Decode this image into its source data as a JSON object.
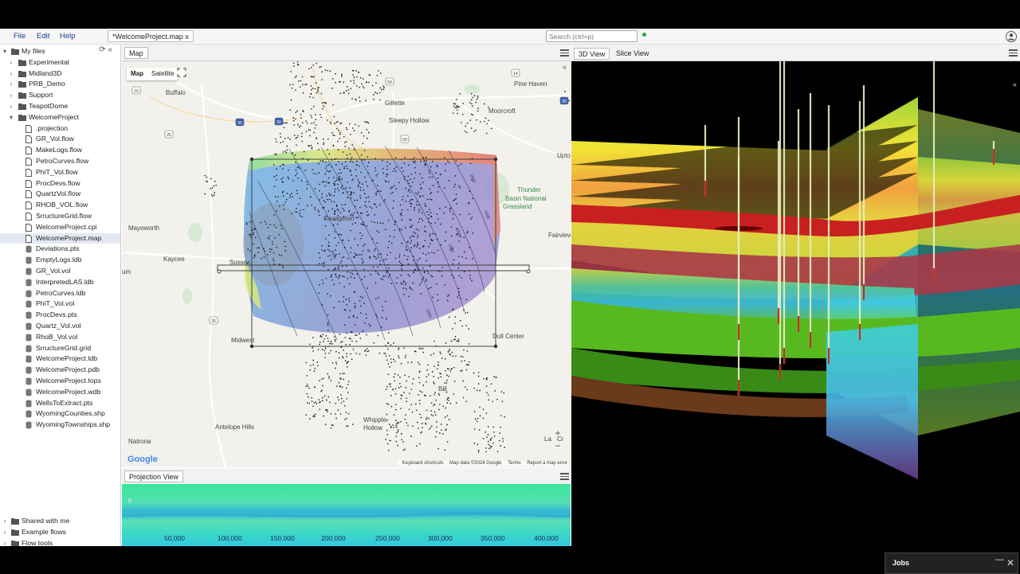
{
  "menu": {
    "file": "File",
    "edit": "Edit",
    "help": "Help"
  },
  "document_tab": "*WelcomeProject.map x",
  "search": {
    "placeholder": "Search (ctrl+p)"
  },
  "sidebar": {
    "root": "My files",
    "folders": [
      "Experimental",
      "Midland3D",
      "PRB_Demo",
      "Support",
      "TeapotDome"
    ],
    "open_folder": "WelcomeProject",
    "files": [
      {
        "name": ".projection",
        "type": "file-doc"
      },
      {
        "name": "GR_Vol.flow",
        "type": "file-doc"
      },
      {
        "name": "MakeLogs.flow",
        "type": "file-doc"
      },
      {
        "name": "PetroCurves.flow",
        "type": "file-doc"
      },
      {
        "name": "PhiT_Vol.flow",
        "type": "file-doc"
      },
      {
        "name": "ProcDevs.flow",
        "type": "file-doc"
      },
      {
        "name": "QuartzVol.flow",
        "type": "file-doc"
      },
      {
        "name": "RHOB_VOL.flow",
        "type": "file-doc"
      },
      {
        "name": "SrructureGrid.flow",
        "type": "file-doc"
      },
      {
        "name": "WelcomeProject.cpi",
        "type": "file-doc"
      },
      {
        "name": "WelcomeProject.map",
        "type": "file-doc",
        "selected": true
      },
      {
        "name": "Deviations.pts",
        "type": "database"
      },
      {
        "name": "EmptyLogs.ldb",
        "type": "database"
      },
      {
        "name": "GR_Vol.vol",
        "type": "database"
      },
      {
        "name": "InterpretedLAS.ldb",
        "type": "database"
      },
      {
        "name": "PetroCurves.ldb",
        "type": "database"
      },
      {
        "name": "PhiT_Vol.vol",
        "type": "database"
      },
      {
        "name": "ProcDevs.pts",
        "type": "database"
      },
      {
        "name": "Quartz_Vol.vol",
        "type": "database"
      },
      {
        "name": "RhoB_Vol.vol",
        "type": "database"
      },
      {
        "name": "SrructureGrid.grid",
        "type": "database"
      },
      {
        "name": "WelcomeProject.ldb",
        "type": "database"
      },
      {
        "name": "WelcomeProject.pdb",
        "type": "database"
      },
      {
        "name": "WelcomeProject.tops",
        "type": "database"
      },
      {
        "name": "WelcomeProject.wdb",
        "type": "database"
      },
      {
        "name": "WellsToExtract.pts",
        "type": "database"
      },
      {
        "name": "WyomingCounties.shp",
        "type": "database"
      },
      {
        "name": "WyomingTownships.shp",
        "type": "database"
      }
    ],
    "bottom": [
      "Shared with me",
      "Example flows",
      "Flow tools"
    ]
  },
  "map_panel": {
    "tab": "Map",
    "map_type": {
      "map": "Map",
      "satellite": "Satellite"
    },
    "places": [
      "Buffalo",
      "Gillette",
      "Sleepy Hollow",
      "Pine Haven",
      "Moorcroft",
      "Upto",
      "Thunder",
      "Basin National",
      "Grassland",
      "Mayoworth",
      "Kaycee",
      "Fairview",
      "Sussex",
      "um",
      "Midwest",
      "Dull Center",
      "Bill",
      "Antelope Hills",
      "Whipple",
      "Hollow",
      "Natrona",
      "La",
      "Cr",
      "Savageton"
    ],
    "highway_shields": [
      "16",
      "14",
      "90",
      "90",
      "59",
      "90",
      "25",
      "25",
      "59"
    ],
    "contour_labels": [
      "1500",
      "1500",
      "1000",
      "2500",
      "2000",
      "2000",
      "4000"
    ],
    "google": "Google",
    "footer": [
      "Keyboard shortcuts",
      "Map data ©2024 Google",
      "Terms",
      "Report a map error"
    ]
  },
  "projection_panel": {
    "tab": "Projection View",
    "marker": "0",
    "x_ticks": [
      "50,000",
      "100,000",
      "150,000",
      "200,000",
      "250,000",
      "300,000",
      "350,000",
      "400,000"
    ]
  },
  "view3d": {
    "tab_3d": "3D View",
    "tab_slice": "Slice View"
  },
  "jobs": {
    "title": "Jobs",
    "minimize": "—",
    "close": "✕"
  },
  "colors": {
    "accent_blue": "#1a3d8a",
    "status_green": "#22aa33"
  }
}
